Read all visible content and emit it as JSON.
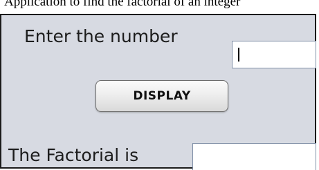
{
  "caption": "Application to find the factorial of an integer",
  "form": {
    "number_label": "Enter the number",
    "number_value": "",
    "display_button": "DISPLAY",
    "result_label": "The Factorial is",
    "result_value": ""
  }
}
